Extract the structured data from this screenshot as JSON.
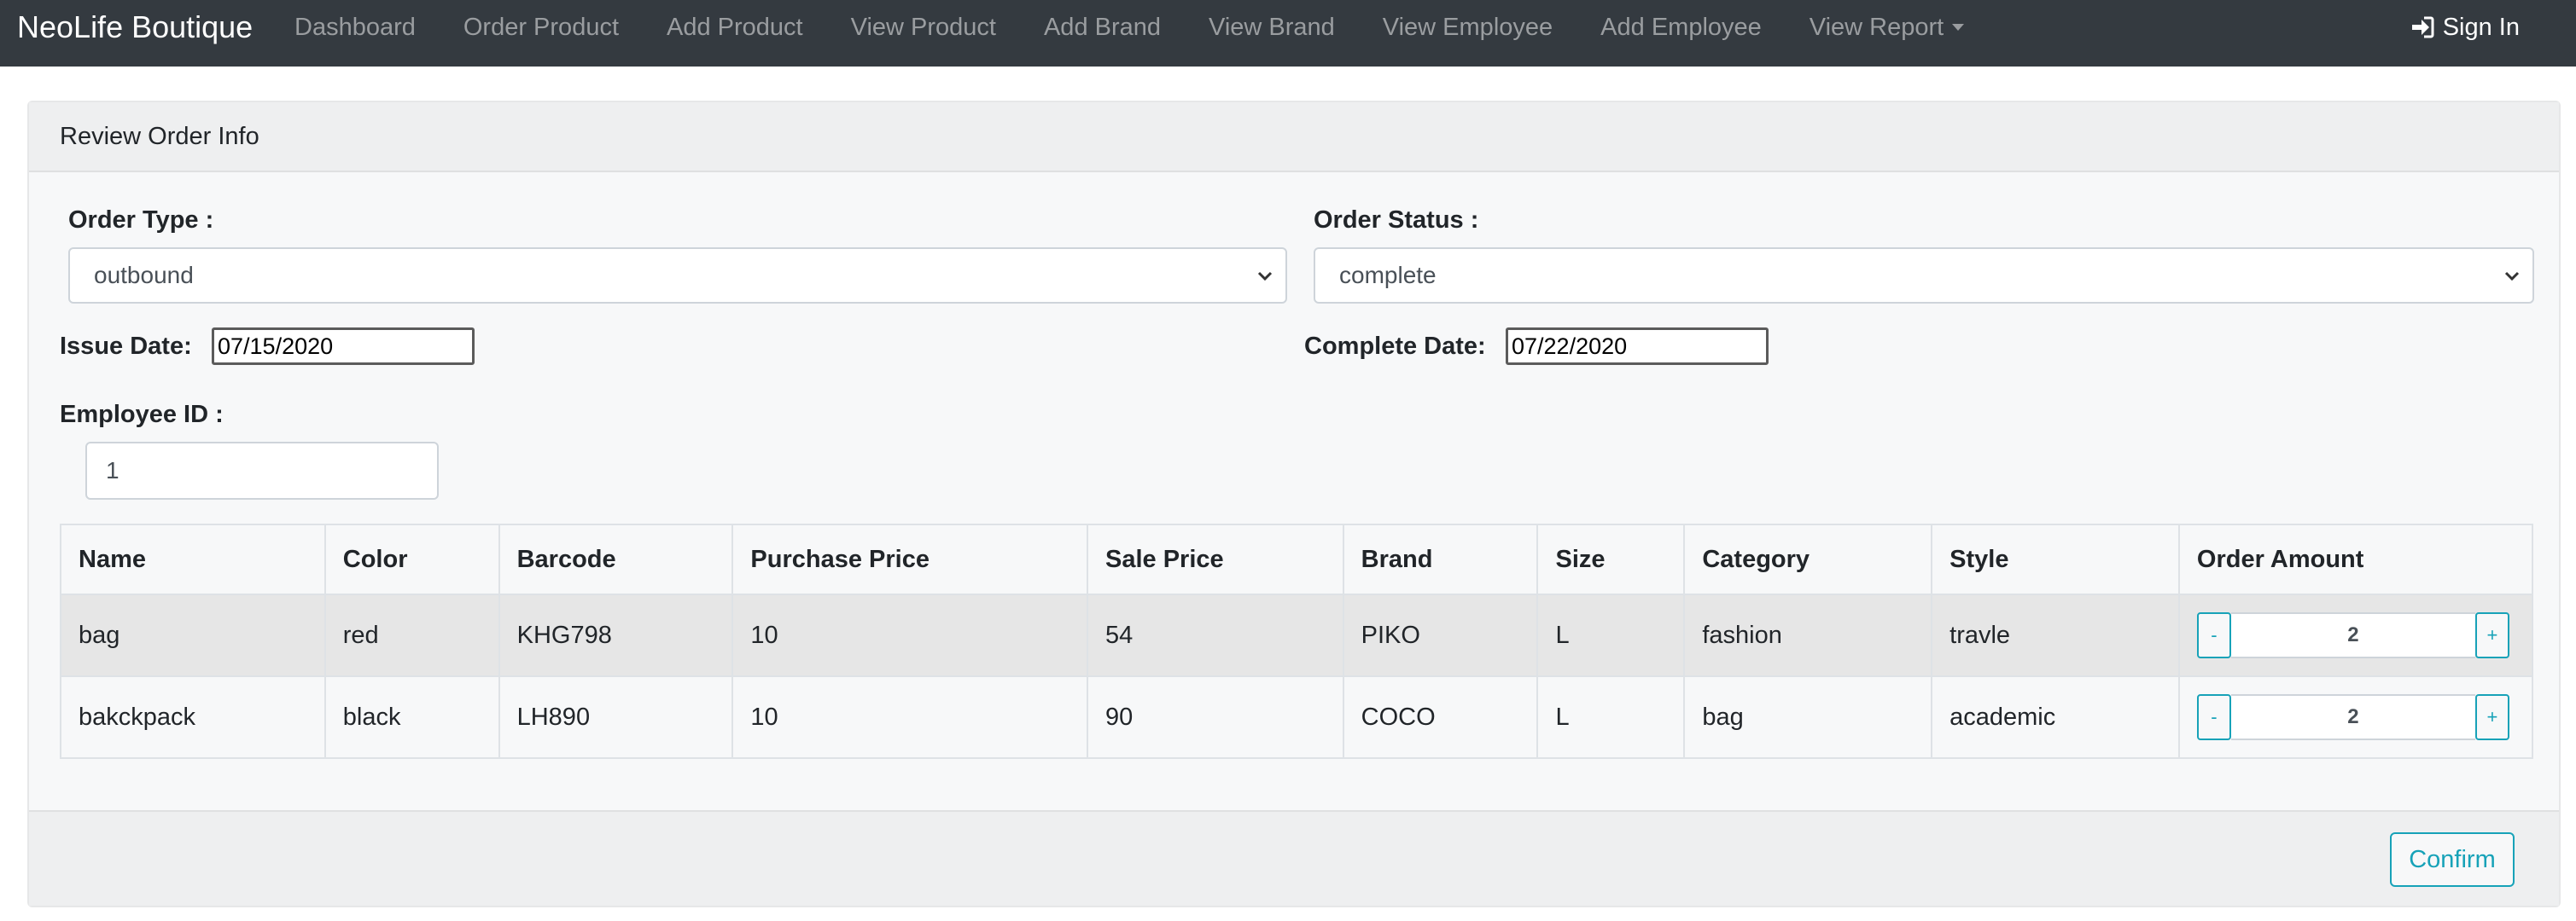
{
  "navbar": {
    "brand": "NeoLife Boutique",
    "links": [
      "Dashboard",
      "Order Product",
      "Add Product",
      "View Product",
      "Add Brand",
      "View Brand",
      "View Employee",
      "Add Employee"
    ],
    "report_label": "View Report",
    "sign_in": "Sign In",
    "sign_in_icon": "sign-in-icon"
  },
  "card": {
    "title": "Review Order Info",
    "order_type_label": "Order Type :",
    "order_type_value": "outbound",
    "order_status_label": "Order Status :",
    "order_status_value": "complete",
    "issue_date_label": "Issue Date:",
    "issue_date_value": "07/15/2020",
    "complete_date_label": "Complete Date:",
    "complete_date_value": "07/22/2020",
    "employee_label": "Employee ID :",
    "employee_value": "1",
    "confirm_label": "Confirm"
  },
  "table": {
    "headers": [
      "Name",
      "Color",
      "Barcode",
      "Purchase Price",
      "Sale Price",
      "Brand",
      "Size",
      "Category",
      "Style",
      "Order Amount"
    ],
    "rows": [
      [
        "bag",
        "red",
        "KHG798",
        "10",
        "54",
        "PIKO",
        "L",
        "fashion",
        "travle",
        "2"
      ],
      [
        "bakckpack",
        "black",
        "LH890",
        "10",
        "90",
        "COCO",
        "L",
        "bag",
        "academic",
        "2"
      ]
    ],
    "minus": "-",
    "plus": "+"
  },
  "colors": {
    "navbar": "#343a40",
    "accent": "#17a2b8"
  }
}
